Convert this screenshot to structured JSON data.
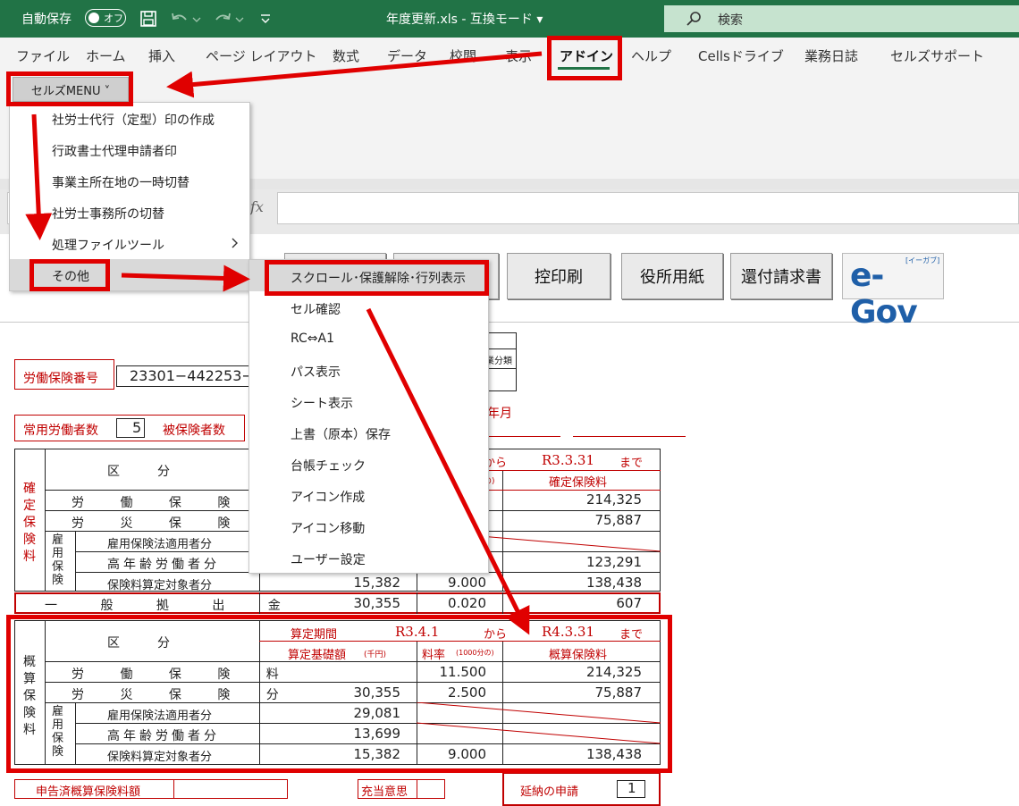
{
  "titlebar": {
    "autosave_label": "自動保存",
    "autosave_state": "オフ",
    "filename": "年度更新.xls  -  互換モード ▾",
    "search_placeholder": "検索"
  },
  "ribbon_tabs": [
    "ファイル",
    "ホーム",
    "挿入",
    "ページ レイアウト",
    "数式",
    "データ",
    "校閲",
    "表示",
    "アドイン",
    "ヘルプ",
    "Cellsドライブ",
    "業務日誌",
    "セルズサポート"
  ],
  "cells_menu_label": "セルズMENU ˅",
  "main_menu": {
    "items": [
      "社労士代行（定型）印の作成",
      "行政書士代理申請者印",
      "事業主所在地の一時切替",
      "社労士事務所の切替",
      "処理ファイルツール",
      "その他"
    ]
  },
  "sub_menu": {
    "items": [
      "スクロール･保護解除･行列表示",
      "セル確認",
      "RC⇔A1",
      "パス表示",
      "シート表示",
      "上書（原本）保存",
      "台帳チェック",
      "アイコン作成",
      "アイコン移動",
      "ユーザー設定"
    ]
  },
  "fx_label": "fx",
  "sheet_buttons": [
    "控印刷",
    "役所用紙",
    "還付請求書"
  ],
  "egov_logo": "e-Gov",
  "egov_small": "[イーガブ]",
  "form": {
    "labor_no_label": "労働保険番号",
    "labor_no_value": "23301−442253−00",
    "workers_label": "常用労働者数",
    "workers_value": "5",
    "insured_label": "被保険者数",
    "year_month": "年月",
    "right_code_box": "業分類",
    "kakutei": {
      "side": "確定保険料",
      "period_from_word": "から",
      "period_to": "R3.3.31",
      "period_to_word": "まで",
      "header_col": "確定保険料",
      "rate_unit_fragment": "の)",
      "header_kubun": "区　　　分",
      "rows": [
        {
          "label": "労 働 保 険 料",
          "base": "",
          "rate": "",
          "amount": "214,325"
        },
        {
          "label": "労 災 保 険 分",
          "base": "",
          "rate": "",
          "amount": "75,887"
        },
        {
          "label": "雇用保険法適用者分",
          "base": "",
          "rate": "",
          "amount": ""
        },
        {
          "label": "高年齢労働者分",
          "base": "",
          "rate": "",
          "amount": "123,291"
        },
        {
          "label": "保険料算定対象者分",
          "base": "15,382",
          "rate": "9.000",
          "amount": "138,438"
        }
      ],
      "koyou_side": "雇用保険"
    },
    "ippan": {
      "label": "一 般 拠 出 金",
      "base": "30,355",
      "rate": "0.020",
      "amount": "607"
    },
    "gaisan": {
      "side": "概算保険料",
      "period_label": "算定期間",
      "period_from": "R3.4.1",
      "period_from_word": "から",
      "period_to": "R4.3.31",
      "period_to_word": "まで",
      "header_base": "算定基礎額",
      "header_base_unit": "(千円)",
      "header_rate": "料率",
      "header_rate_unit": "(1000分の)",
      "header_amount": "概算保険料",
      "header_kubun": "区　　　分",
      "koyou_side": "雇用保険",
      "rows": [
        {
          "label": "労 働 保 険 料",
          "base": "",
          "rate": "11.500",
          "amount": "214,325"
        },
        {
          "label": "労 災 保 険 分",
          "base": "30,355",
          "rate": "2.500",
          "amount": "75,887"
        },
        {
          "label": "雇用保険法適用者分",
          "base": "29,081",
          "rate": "",
          "amount": ""
        },
        {
          "label": "高年齢労働者分",
          "base": "13,699",
          "rate": "",
          "amount": ""
        },
        {
          "label": "保険料算定対象者分",
          "base": "15,382",
          "rate": "9.000",
          "amount": "138,438"
        }
      ]
    },
    "footer": {
      "shinkoku_label": "申告済概算保険料額",
      "juto_label": "充当意思",
      "ennou_label": "延納の申請",
      "ennou_value": "1"
    }
  },
  "colors": {
    "excel_green": "#217346",
    "annotation_red": "#e00000",
    "form_red": "#c00000"
  }
}
